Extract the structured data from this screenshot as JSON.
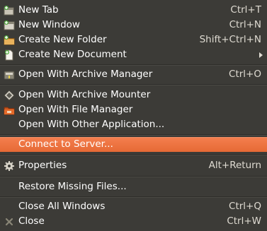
{
  "colors": {
    "menu_background": "#3c3b37",
    "highlight": "#f07746",
    "text": "#ffffff",
    "accelerator_text": "#dfdbd2"
  },
  "menu": {
    "items": [
      {
        "label": "New Tab",
        "accel": "Ctrl+T",
        "icon": "new-tab-icon"
      },
      {
        "label": "New Window",
        "accel": "Ctrl+N",
        "icon": "new-window-icon"
      },
      {
        "label": "Create New Folder",
        "accel": "Shift+Ctrl+N",
        "icon": "new-folder-icon"
      },
      {
        "label": "Create New Document",
        "accel": "",
        "icon": "new-document-icon",
        "submenu": true
      },
      {
        "label": "Open With Archive Manager",
        "accel": "Ctrl+O",
        "icon": "archive-manager-icon"
      },
      {
        "label": "Open With Archive Mounter",
        "accel": "",
        "icon": "archive-mounter-icon"
      },
      {
        "label": "Open With File Manager",
        "accel": "",
        "icon": "file-manager-icon"
      },
      {
        "label": "Open With Other Application...",
        "accel": "",
        "icon": ""
      },
      {
        "label": "Connect to Server...",
        "accel": "",
        "icon": "",
        "selected": true
      },
      {
        "label": "Properties",
        "accel": "Alt+Return",
        "icon": "gear-icon"
      },
      {
        "label": "Restore Missing Files...",
        "accel": "",
        "icon": ""
      },
      {
        "label": "Close All Windows",
        "accel": "Ctrl+Q",
        "icon": ""
      },
      {
        "label": "Close",
        "accel": "Ctrl+W",
        "icon": "close-icon"
      }
    ]
  }
}
